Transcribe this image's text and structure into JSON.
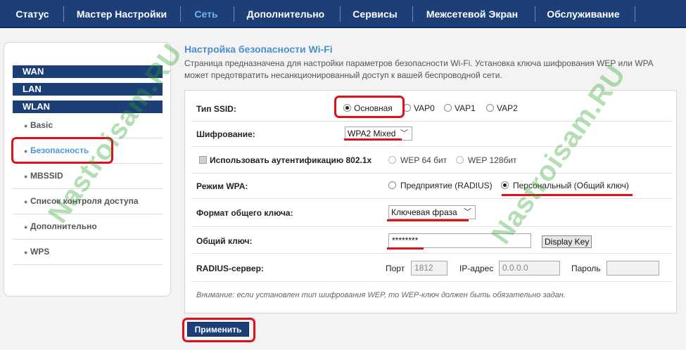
{
  "nav": {
    "items": [
      "Статус",
      "Мастер Настройки",
      "Сеть",
      "Дополнительно",
      "Сервисы",
      "Межсетевой Экран",
      "Обслуживание"
    ],
    "active_index": 2
  },
  "sidebar": {
    "headers": [
      "WAN",
      "LAN",
      "WLAN"
    ],
    "items": [
      "Basic",
      "Безопасность",
      "MBSSID",
      "Список контроля доступа",
      "Дополнительно",
      "WPS"
    ],
    "active_index": 1
  },
  "page": {
    "title": "Настройка безопасности Wi-Fi",
    "description_line1": "Страница предназначена для настройки параметров безопасности Wi-Fi. Установка ключа шифрования WEP или WPA",
    "description_line2": "может предотвратить несанкционированный доступ к вашей беспроводной сети."
  },
  "form": {
    "ssid_type": {
      "label": "Тип SSID:",
      "options": [
        "Основная",
        "VAP0",
        "VAP1",
        "VAP2"
      ],
      "selected": "Основная"
    },
    "encryption": {
      "label": "Шифрование:",
      "value": "WPA2 Mixed"
    },
    "auth_8021x": {
      "label": "Использовать аутентификацию 802.1x",
      "checked": false,
      "options": [
        "WEP 64 бит",
        "WEP 128бит"
      ]
    },
    "wpa_mode": {
      "label": "Режим WPA:",
      "options": [
        "Предприятие (RADIUS)",
        "Персональный (Общий ключ)"
      ],
      "selected": "Персональный (Общий ключ)"
    },
    "key_format": {
      "label": "Формат общего ключа:",
      "value": "Ключевая фраза"
    },
    "shared_key": {
      "label": "Общий ключ:",
      "value": "********",
      "display_button": "Display Key"
    },
    "radius": {
      "label": "RADIUS-сервер:",
      "port_label": "Порт",
      "port_value": "1812",
      "ip_label": "IP-адрес",
      "ip_value": "0.0.0.0",
      "password_label": "Пароль",
      "password_value": ""
    },
    "note": "Внимание: если установлен тип шифрования WEP, то WEP-ключ должен быть обязательно задан."
  },
  "apply_button": "Применить",
  "watermark": "Nastroisam.RU",
  "colors": {
    "nav_bg": "#1c3f78",
    "active_link": "#4f96d8",
    "annotation": "#e0101a"
  }
}
